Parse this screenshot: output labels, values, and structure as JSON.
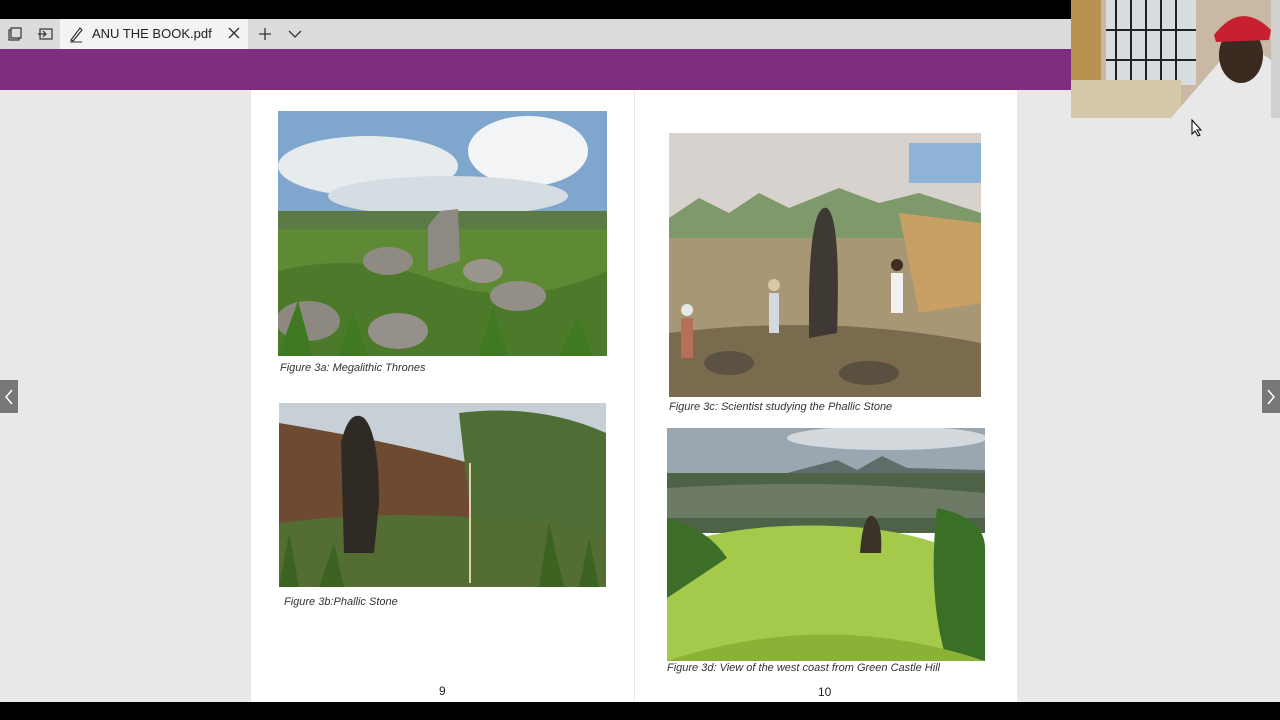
{
  "tab": {
    "title": "ANU THE BOOK.pdf"
  },
  "icons": {
    "tab_actions": "tab-actions-icon",
    "set_aside": "set-aside-tabs-icon",
    "pdf_pen": "pen-icon",
    "close": "close-icon",
    "new_tab": "plus-icon",
    "tab_list": "chevron-down-icon",
    "prev_page": "chevron-left-icon",
    "next_page": "chevron-right-icon"
  },
  "colors": {
    "accent_bar": "#7d2e7f",
    "tab_bar": "#dcdcdc",
    "viewer_bg": "#e8e8e8"
  },
  "document": {
    "pages": [
      {
        "number": "9",
        "figures": [
          {
            "caption": "Figure 3a: Megalithic Thrones"
          },
          {
            "caption": "Figure 3b:Phallic Stone"
          }
        ]
      },
      {
        "number": "10",
        "figures": [
          {
            "caption": "Figure 3c: Scientist studying the Phallic Stone"
          },
          {
            "caption": "Figure 3d: View of the west coast from Green Castle Hill"
          }
        ]
      }
    ]
  }
}
